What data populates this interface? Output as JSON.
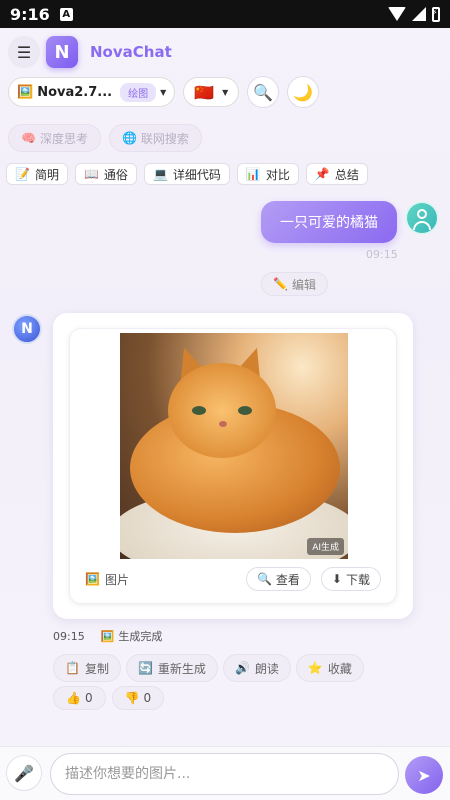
{
  "status_bar": {
    "time": "9:16",
    "notif_icon": "A"
  },
  "header": {
    "menu_icon": "☰",
    "logo_letter": "N",
    "app_name": "NovaChat"
  },
  "toolbar": {
    "model_icon": "🖼️",
    "model_name": "Nova2.7...",
    "model_tag": "绘图",
    "flag": "🇨🇳",
    "search_icon": "🔍",
    "theme_icon": "🌙"
  },
  "modes": [
    {
      "icon": "🧠",
      "label": "深度思考"
    },
    {
      "icon": "🌐",
      "label": "联网搜索"
    }
  ],
  "styles": [
    {
      "icon": "📝",
      "label": "简明"
    },
    {
      "icon": "📖",
      "label": "通俗"
    },
    {
      "icon": "💻",
      "label": "详细代码"
    },
    {
      "icon": "📊",
      "label": "对比"
    },
    {
      "icon": "📌",
      "label": "总结"
    }
  ],
  "user_message": {
    "text": "一只可爱的橘猫",
    "time": "09:15",
    "edit_icon": "✏️",
    "edit_label": "编辑"
  },
  "bot_message": {
    "avatar_letter": "N",
    "ai_tag": "AI生成",
    "image_icon": "🖼️",
    "image_label": "图片",
    "view_icon": "🔍",
    "view_label": "查看",
    "download_icon": "⬇",
    "download_label": "下载",
    "time": "09:15",
    "status_icon": "🖼️",
    "status_text": "生成完成"
  },
  "actions": [
    {
      "icon": "📋",
      "label": "复制"
    },
    {
      "icon": "🔄",
      "label": "重新生成"
    },
    {
      "icon": "🔊",
      "label": "朗读"
    },
    {
      "icon": "⭐",
      "label": "收藏"
    }
  ],
  "votes": {
    "up_icon": "👍",
    "up_count": "0",
    "down_icon": "👎",
    "down_count": "0"
  },
  "input": {
    "mic_icon": "🎤",
    "placeholder": "描述你想要的图片...",
    "value": "",
    "send_icon": "➤"
  }
}
